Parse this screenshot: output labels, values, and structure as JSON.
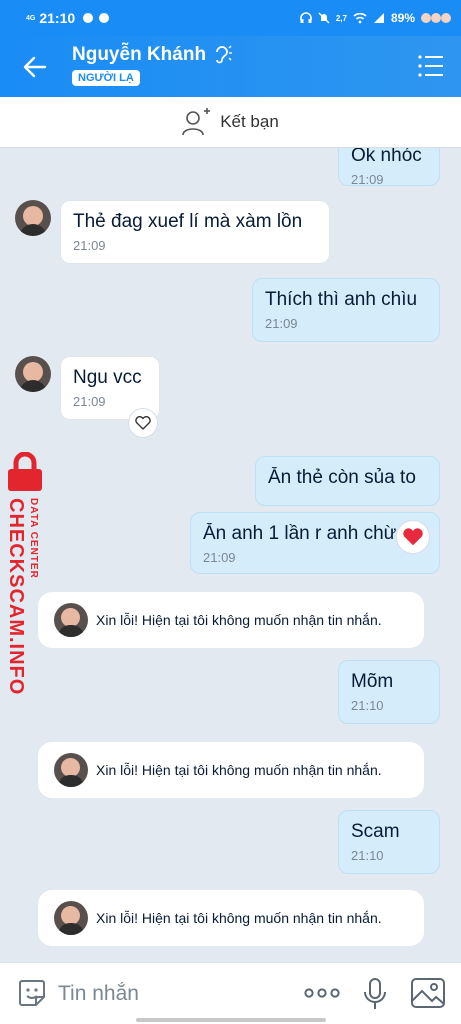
{
  "status_bar": {
    "network": "4G",
    "time": "21:10",
    "battery": "89%",
    "speed": "2,7"
  },
  "header": {
    "contact_name": "Nguyễn Khánh",
    "stranger_badge": "NGƯỜI LẠ"
  },
  "friend_bar": {
    "label": "Kết bạn"
  },
  "messages": [
    {
      "side": "out",
      "text": "Ok nhóc",
      "time": "21:09"
    },
    {
      "side": "in",
      "text": "Thẻ đag xuef lí mà xàm lồn",
      "time": "21:09"
    },
    {
      "side": "out",
      "text": "Thích thì anh chìu",
      "time": "21:09"
    },
    {
      "side": "in",
      "text": "Ngu vcc",
      "time": "21:09"
    },
    {
      "side": "out",
      "text": "Ăn thẻ còn sủa to",
      "time": ""
    },
    {
      "side": "out",
      "text": "Ăn anh 1 lần r anh chừa",
      "time": "21:09"
    },
    {
      "side": "out",
      "text": "Mõm",
      "time": "21:10"
    },
    {
      "side": "out",
      "text": "Scam",
      "time": "21:10"
    }
  ],
  "notices": [
    {
      "text": "Xin lỗi! Hiện tại tôi không muốn nhận tin nhắn."
    },
    {
      "text": "Xin lỗi! Hiện tại tôi không muốn nhận tin nhắn."
    },
    {
      "text": "Xin lỗi! Hiện tại tôi không muốn nhận tin nhắn."
    }
  ],
  "watermark": {
    "main": "CHECKSCAM.INFO",
    "sub": "DATA CENTER"
  },
  "input_bar": {
    "placeholder": "Tin nhắn"
  },
  "colors": {
    "brand": "#1a8cf5",
    "outgoing_bubble": "#d5ecfb",
    "chat_background": "#e2e9f1",
    "watermark": "#e3262e",
    "heart": "#e8283c"
  },
  "icons": {
    "back": "arrow-left-icon",
    "menu": "list-menu-icon",
    "add_friend": "add-user-icon",
    "react": "heart-icon",
    "sticker": "sticker-icon",
    "more": "more-dots-icon",
    "mic": "microphone-icon",
    "image": "image-icon"
  }
}
